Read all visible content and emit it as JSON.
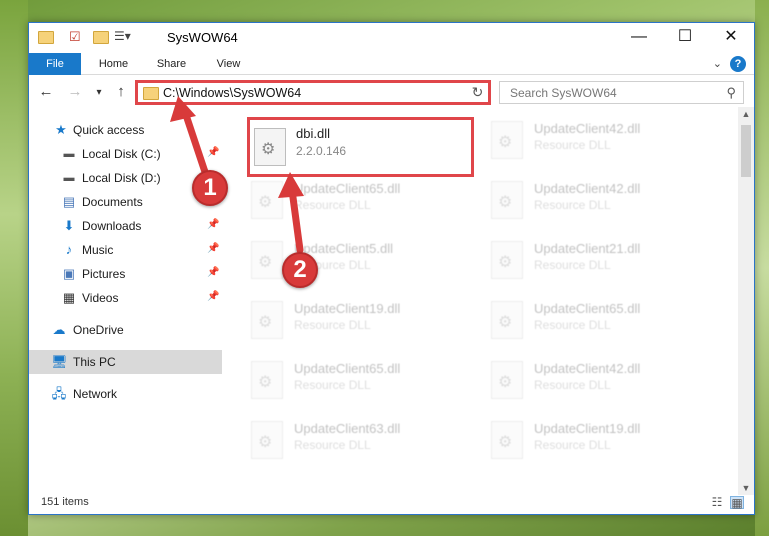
{
  "window": {
    "title": "SysWOW64"
  },
  "titlebar": {
    "minimize": "—",
    "maximize": "☐",
    "close": "✕"
  },
  "ribbon": {
    "tabs": [
      "File",
      "Home",
      "Share",
      "View"
    ],
    "help": "?"
  },
  "nav": {
    "address": "C:\\Windows\\SysWOW64",
    "search_placeholder": "Search SysWOW64"
  },
  "sidebar": {
    "items": [
      {
        "label": "Quick access",
        "icon": "star-icon"
      },
      {
        "label": "Local Disk (C:)",
        "icon": "drive-icon",
        "pinned": true
      },
      {
        "label": "Local Disk (D:)",
        "icon": "drive-icon"
      },
      {
        "label": "Documents",
        "icon": "documents-icon",
        "pinned": true
      },
      {
        "label": "Downloads",
        "icon": "download-icon",
        "pinned": true
      },
      {
        "label": "Music",
        "icon": "music-icon",
        "pinned": true
      },
      {
        "label": "Pictures",
        "icon": "pictures-icon",
        "pinned": true
      },
      {
        "label": "Videos",
        "icon": "videos-icon",
        "pinned": true
      },
      {
        "label": "OneDrive",
        "icon": "cloud-icon"
      },
      {
        "label": "This PC",
        "icon": "computer-icon",
        "selected": true
      },
      {
        "label": "Network",
        "icon": "network-icon"
      }
    ]
  },
  "files": [
    {
      "name": "dbi.dll",
      "desc": "2.2.0.146",
      "highlighted": true
    },
    {
      "name": "UpdateClient42.dll",
      "desc": "Resource DLL"
    },
    {
      "name": "UpdateClient65.dll",
      "desc": "Resource DLL"
    },
    {
      "name": "UpdateClient42.dll",
      "desc": "Resource DLL"
    },
    {
      "name": "UpdateClient5.dll",
      "desc": "Resource DLL"
    },
    {
      "name": "UpdateClient21.dll",
      "desc": "Resource DLL"
    },
    {
      "name": "UpdateClient19.dll",
      "desc": "Resource DLL"
    },
    {
      "name": "UpdateClient65.dll",
      "desc": "Resource DLL"
    },
    {
      "name": "UpdateClient65.dll",
      "desc": "Resource DLL"
    },
    {
      "name": "UpdateClient42.dll",
      "desc": "Resource DLL"
    },
    {
      "name": "UpdateClient63.dll",
      "desc": "Resource DLL"
    },
    {
      "name": "UpdateClient19.dll",
      "desc": "Resource DLL"
    }
  ],
  "status": {
    "item_count": "151 items"
  },
  "callouts": [
    "1",
    "2"
  ],
  "colors": {
    "accent": "#1979ca",
    "annotation_red": "#e0464a"
  }
}
